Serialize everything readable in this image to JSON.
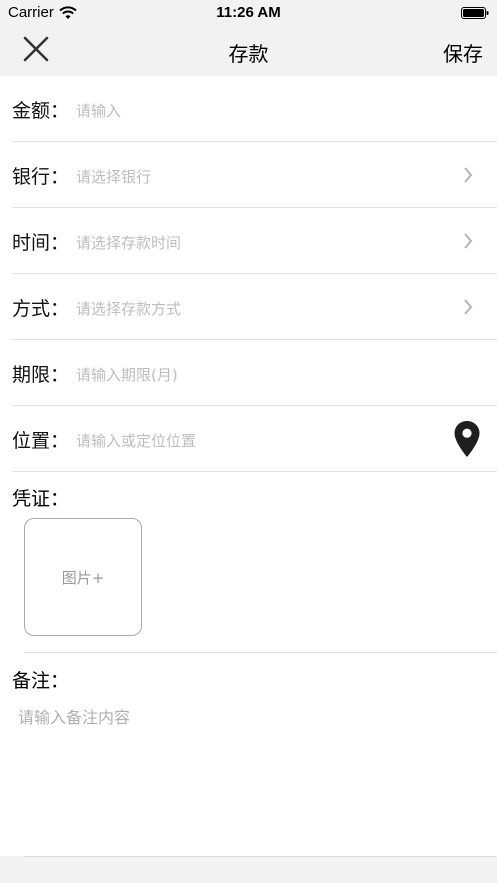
{
  "status_bar": {
    "carrier": "Carrier",
    "time": "11:26 AM"
  },
  "nav": {
    "title": "存款",
    "save_label": "保存",
    "close_icon": "close-icon"
  },
  "form": {
    "rows": [
      {
        "label": "金额：",
        "placeholder": "请输入"
      },
      {
        "label": "银行：",
        "placeholder": "请选择银行"
      },
      {
        "label": "时间：",
        "placeholder": "请选择存款时间"
      },
      {
        "label": "方式：",
        "placeholder": "请选择存款方式"
      },
      {
        "label": "期限：",
        "placeholder": "请输入期限(月)"
      },
      {
        "label": "位置：",
        "placeholder": "请输入或定位位置"
      }
    ],
    "voucher": {
      "label": "凭证：",
      "photo_button": "图片+"
    },
    "remark": {
      "label": "备注：",
      "placeholder": "请输入备注内容"
    }
  },
  "colors": {
    "background": "#f2f2f2",
    "card": "#ffffff",
    "placeholder": "#bdbdbd",
    "divider": "#e3e3e3"
  }
}
